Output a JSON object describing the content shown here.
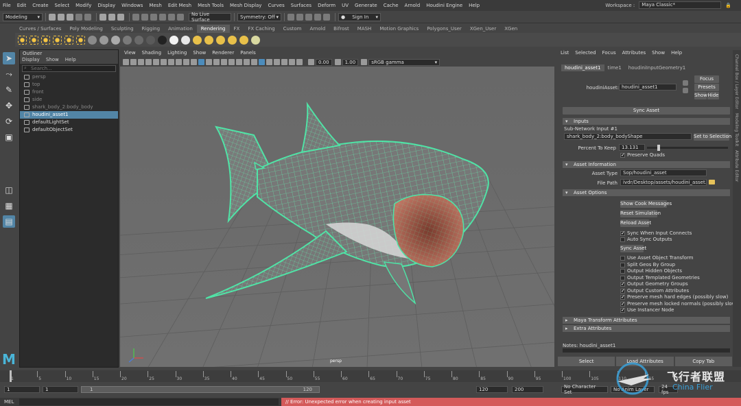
{
  "menubar": {
    "items": [
      "File",
      "Edit",
      "Create",
      "Select",
      "Modify",
      "Display",
      "Windows",
      "Mesh",
      "Edit Mesh",
      "Mesh Tools",
      "Mesh Display",
      "Curves",
      "Surfaces",
      "Deform",
      "UV",
      "Generate",
      "Cache",
      "Arnold",
      "Houdini Engine",
      "Help"
    ],
    "workspace_label": "Workspace :",
    "workspace_value": "Maya Classic*"
  },
  "statusline": {
    "menuset": "Modeling",
    "live_surface": "No Live Surface",
    "symmetry": "Symmetry: Off",
    "sign_in": "Sign In"
  },
  "shelf": {
    "tabs": [
      "Curves / Surfaces",
      "Poly Modeling",
      "Sculpting",
      "Rigging",
      "Animation",
      "Rendering",
      "FX",
      "FX Caching",
      "Custom",
      "Arnold",
      "Bifrost",
      "MASH",
      "Motion Graphics",
      "Polygons_User",
      "XGen_User",
      "XGen"
    ],
    "active_tab": "Rendering"
  },
  "outliner": {
    "title": "Outliner",
    "menu": [
      "Display",
      "Show",
      "Help"
    ],
    "search_placeholder": "Search...",
    "items": [
      {
        "label": "persp",
        "state": "dim"
      },
      {
        "label": "top",
        "state": "dim"
      },
      {
        "label": "front",
        "state": "dim"
      },
      {
        "label": "side",
        "state": "dim"
      },
      {
        "label": "shark_body_2:body_body",
        "state": "dim"
      },
      {
        "label": "houdini_asset1",
        "state": "selected"
      },
      {
        "label": "defaultLightSet",
        "state": "normal"
      },
      {
        "label": "defaultObjectSet",
        "state": "normal"
      }
    ]
  },
  "viewport": {
    "menu": [
      "View",
      "Shading",
      "Lighting",
      "Show",
      "Renderer",
      "Panels"
    ],
    "exposure": "0.00",
    "gamma": "1.00",
    "color_space": "sRGB gamma",
    "camera_label": "persp"
  },
  "attribute_editor": {
    "menu": [
      "List",
      "Selected",
      "Focus",
      "Attributes",
      "Show",
      "Help"
    ],
    "tabs": [
      "houdini_asset1",
      "time1",
      "houdiniInputGeometry1"
    ],
    "active_tab": "houdini_asset1",
    "node_label": "houdiniAsset:",
    "node_value": "houdini_asset1",
    "focus": "Focus",
    "presets": "Presets",
    "show": "Show",
    "hide": "Hide",
    "sync_asset_top": "Sync Asset",
    "inputs": {
      "header": "Inputs",
      "subnetwork_label": "Sub-Network Input #1",
      "subnetwork_value": "shark_body_2:body_bodyShape",
      "set_to_selection": "Set to Selection",
      "percent_label": "Percent To Keep",
      "percent_value": "13.131",
      "percent_fraction": 0.13,
      "preserve_quads": "Preserve Quads"
    },
    "asset_info": {
      "header": "Asset Information",
      "type_label": "Asset Type",
      "type_value": "Sop/houdini_asset",
      "path_label": "File Path",
      "path_value": "ivdr/Desktop/assets/houdini_asset.hda"
    },
    "asset_options": {
      "header": "Asset Options",
      "show_cook": "Show Cook Messages",
      "reset_sim": "Reset Simulation",
      "reload": "Reload Asset",
      "sync_when": "Sync When Input Connects",
      "auto_sync": "Auto Sync Outputs",
      "sync_asset": "Sync Asset",
      "checks": [
        {
          "label": "Use Asset Object Transform",
          "checked": false
        },
        {
          "label": "Split Geos By Group",
          "checked": false
        },
        {
          "label": "Output Hidden Objects",
          "checked": false
        },
        {
          "label": "Output Templated Geometries",
          "checked": false
        },
        {
          "label": "Output Geometry Groups",
          "checked": true
        },
        {
          "label": "Output Custom Attributes",
          "checked": true
        },
        {
          "label": "Preserve mesh hard edges (possibly slow)",
          "checked": true
        },
        {
          "label": "Preserve mesh locked normals (possibly slow)",
          "checked": true
        },
        {
          "label": "Use Instancer Node",
          "checked": true
        }
      ]
    },
    "maya_transform": "Maya Transform Attributes",
    "extra_attributes": "Extra Attributes",
    "notes": "Notes: houdini_asset1",
    "bottom_buttons": [
      "Select",
      "Load Attributes",
      "Copy Tab"
    ]
  },
  "right_strip": [
    "Channel Box / Layer Editor",
    "Modeling Toolkit",
    "Attribute Editor"
  ],
  "time": {
    "ticks": [
      "1",
      "5",
      "10",
      "15",
      "20",
      "25",
      "30",
      "35",
      "40",
      "45",
      "50",
      "55",
      "60",
      "65",
      "70",
      "75",
      "80",
      "85",
      "90",
      "95",
      "100",
      "105",
      "110",
      "115",
      "120"
    ],
    "range_start": "1",
    "range_inner_start": "1",
    "range_slider_start": "1",
    "range_slider_end": "120",
    "range_end": "120",
    "range_max": "200",
    "char_set": "No Character Set",
    "anim_layer": "No Anim Layer",
    "fps": "24 fps"
  },
  "cmdline": {
    "label": "MEL",
    "error": "// Error: Unexpected error when creating input asset"
  },
  "watermark": {
    "cn": "飞行者联盟",
    "en": "China Flier"
  },
  "colors": {
    "accent": "#5285a6",
    "wireframe": "#4fe3a6",
    "error": "#d45a5a"
  }
}
